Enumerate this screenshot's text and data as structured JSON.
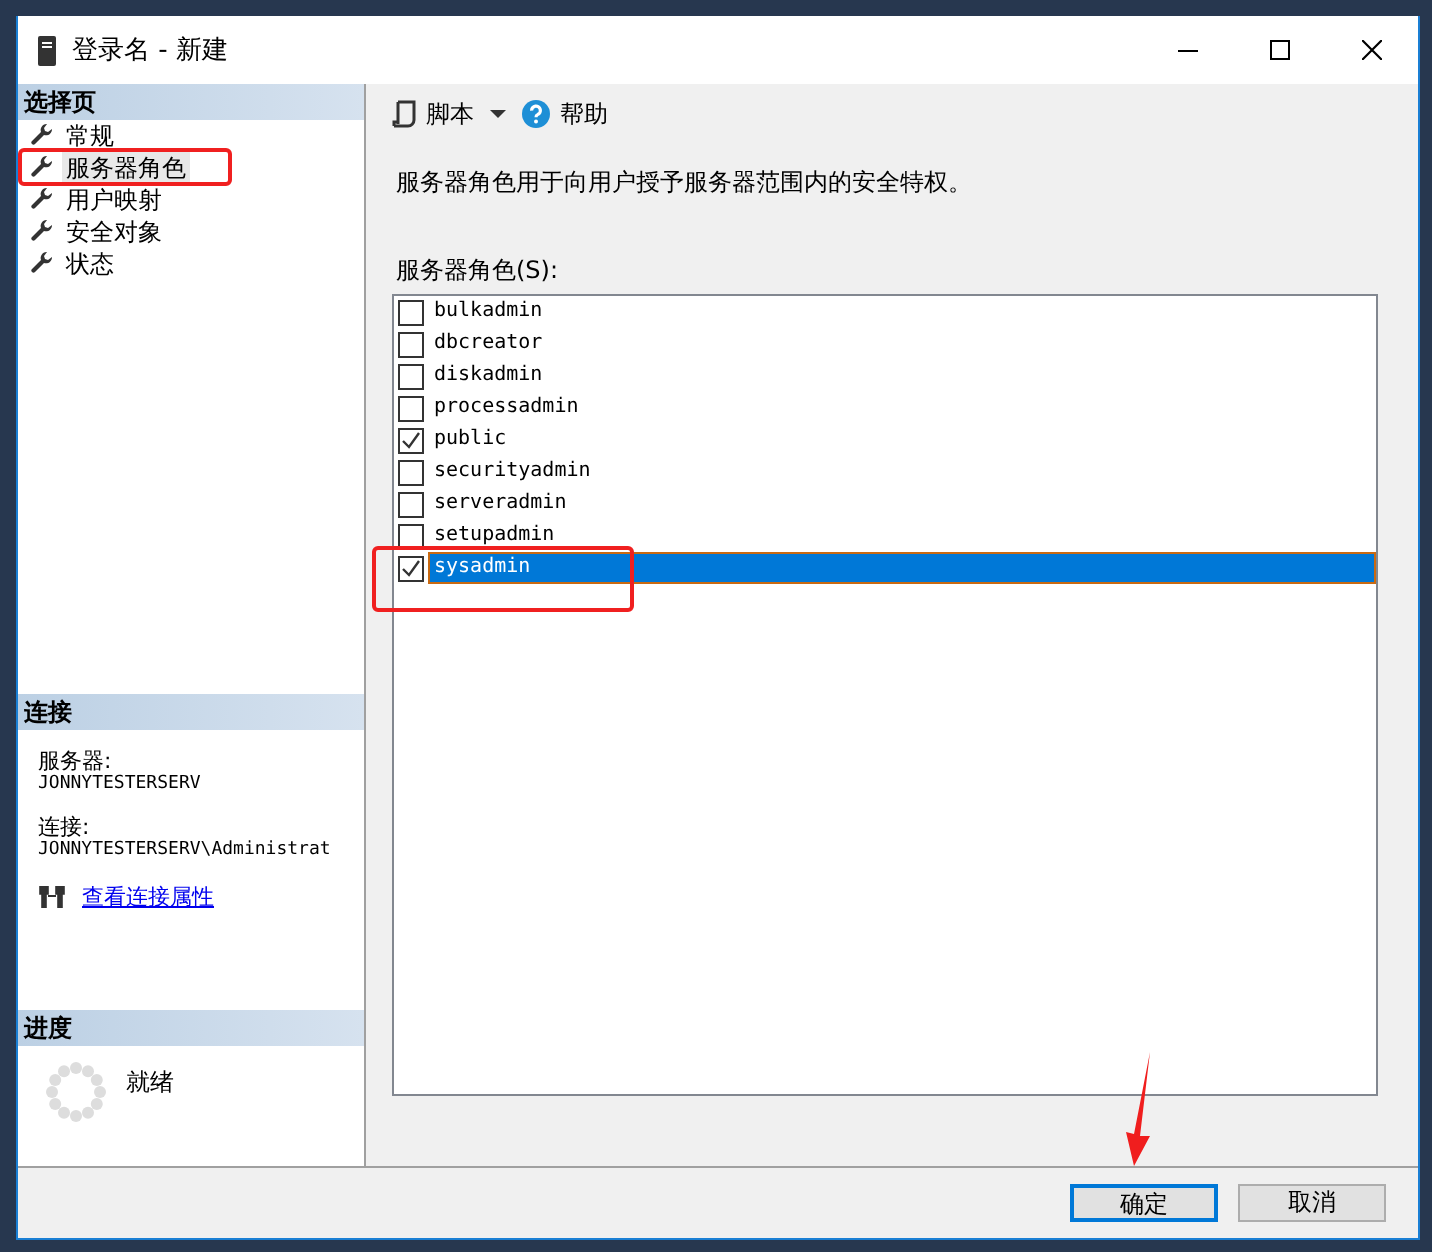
{
  "window": {
    "title": "登录名 - 新建"
  },
  "sidebar": {
    "pages_header": "选择页",
    "pages": [
      {
        "label": "常规",
        "selected": false
      },
      {
        "label": "服务器角色",
        "selected": true
      },
      {
        "label": "用户映射",
        "selected": false
      },
      {
        "label": "安全对象",
        "selected": false
      },
      {
        "label": "状态",
        "selected": false
      }
    ],
    "connection": {
      "header": "连接",
      "server_label": "服务器:",
      "server": "JONNYTESTERSERV",
      "connection_label": "连接:",
      "connection": "JONNYTESTERSERV\\Administrat",
      "link": "查看连接属性"
    },
    "progress": {
      "header": "进度",
      "status": "就绪"
    }
  },
  "toolbar": {
    "script": "脚本",
    "help": "帮助"
  },
  "description": "服务器角色用于向用户授予服务器范围内的安全特权。",
  "roles_label": "服务器角色(S):",
  "roles": [
    {
      "name": "bulkadmin",
      "checked": false,
      "selected": false
    },
    {
      "name": "dbcreator",
      "checked": false,
      "selected": false
    },
    {
      "name": "diskadmin",
      "checked": false,
      "selected": false
    },
    {
      "name": "processadmin",
      "checked": false,
      "selected": false
    },
    {
      "name": "public",
      "checked": true,
      "selected": false
    },
    {
      "name": "securityadmin",
      "checked": false,
      "selected": false
    },
    {
      "name": "serveradmin",
      "checked": false,
      "selected": false
    },
    {
      "name": "setupadmin",
      "checked": false,
      "selected": false
    },
    {
      "name": "sysadmin",
      "checked": true,
      "selected": true
    }
  ],
  "buttons": [
    {
      "label": "确定",
      "default": true
    },
    {
      "label": "取消",
      "default": false
    }
  ]
}
